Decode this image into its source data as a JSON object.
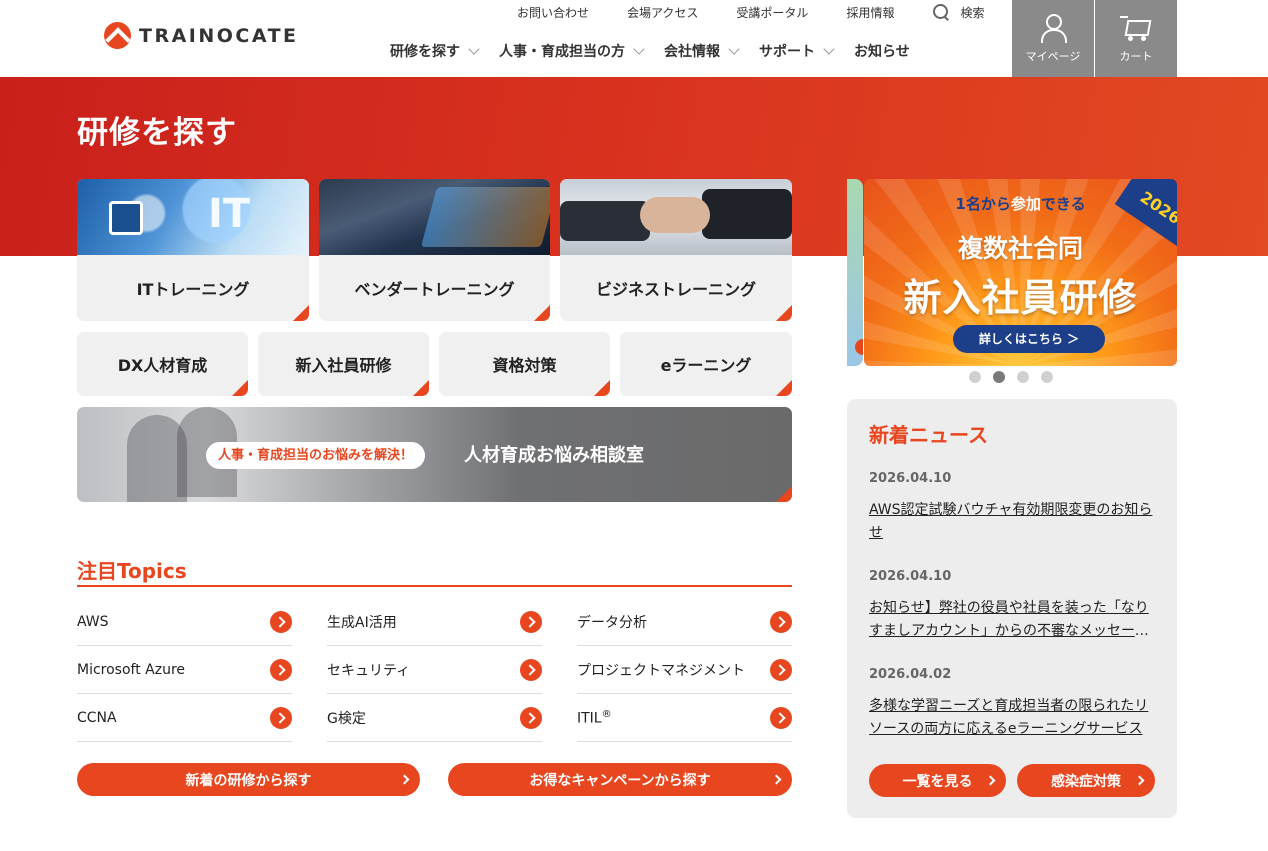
{
  "header": {
    "logo_text": "TRAINOCATE",
    "util_links": [
      "お問い合わせ",
      "会場アクセス",
      "受講ポータル",
      "採用情報"
    ],
    "search_label": "検索",
    "nav": [
      "研修を探す",
      "人事・育成担当の方",
      "会社情報",
      "サポート",
      "お知らせ"
    ],
    "mypage_label": "マイページ",
    "cart_label": "カート"
  },
  "hero": {
    "title": "研修を探す"
  },
  "categories": {
    "big": [
      "ITトレーニング",
      "ベンダートレーニング",
      "ビジネストレーニング"
    ],
    "small": [
      "DX人材育成",
      "新入社員研修",
      "資格対策",
      "eラーニング"
    ],
    "it_image_text": "IT"
  },
  "consult": {
    "badge": "人事・育成担当のお悩みを解決！",
    "title": "人材育成お悩み相談室"
  },
  "topics": {
    "title": "注目Topics",
    "items": [
      "AWS",
      "生成AI活用",
      "データ分析",
      "Microsoft Azure",
      "セキュリティ",
      "プロジェクトマネジメント",
      "CCNA",
      "G検定",
      "ITIL"
    ],
    "itil_sup": "®",
    "buttons": [
      "新着の研修から探す",
      "お得なキャンペーンから探す"
    ]
  },
  "carousel": {
    "line1_a": "1名から",
    "line1_b": "参加",
    "line1_c": "できる",
    "line2": "複数社合同",
    "line3": "新入社員研修",
    "button": "詳しくはこちら ＞",
    "year": "2026",
    "dot_count": 4,
    "active_index": 1
  },
  "news": {
    "title": "新着ニュース",
    "items": [
      {
        "date": "2026.04.10",
        "text": "AWS認定試験バウチャ有効期限変更のお知らせ"
      },
      {
        "date": "2026.04.10",
        "text": "お知らせ】弊社の役員や社員を装った「なりすましアカウント」からの不審なメッセージにご注意ください"
      },
      {
        "date": "2026.04.02",
        "text": "多様な学習ニーズと育成担当者の限られたリソースの両方に応えるeラーニングサービス"
      }
    ],
    "buttons": [
      "一覧を見る",
      "感染症対策"
    ]
  },
  "colors": {
    "accent": "#e8461f",
    "navy": "#1d3f8a",
    "gray_button": "#8a8a8a"
  }
}
